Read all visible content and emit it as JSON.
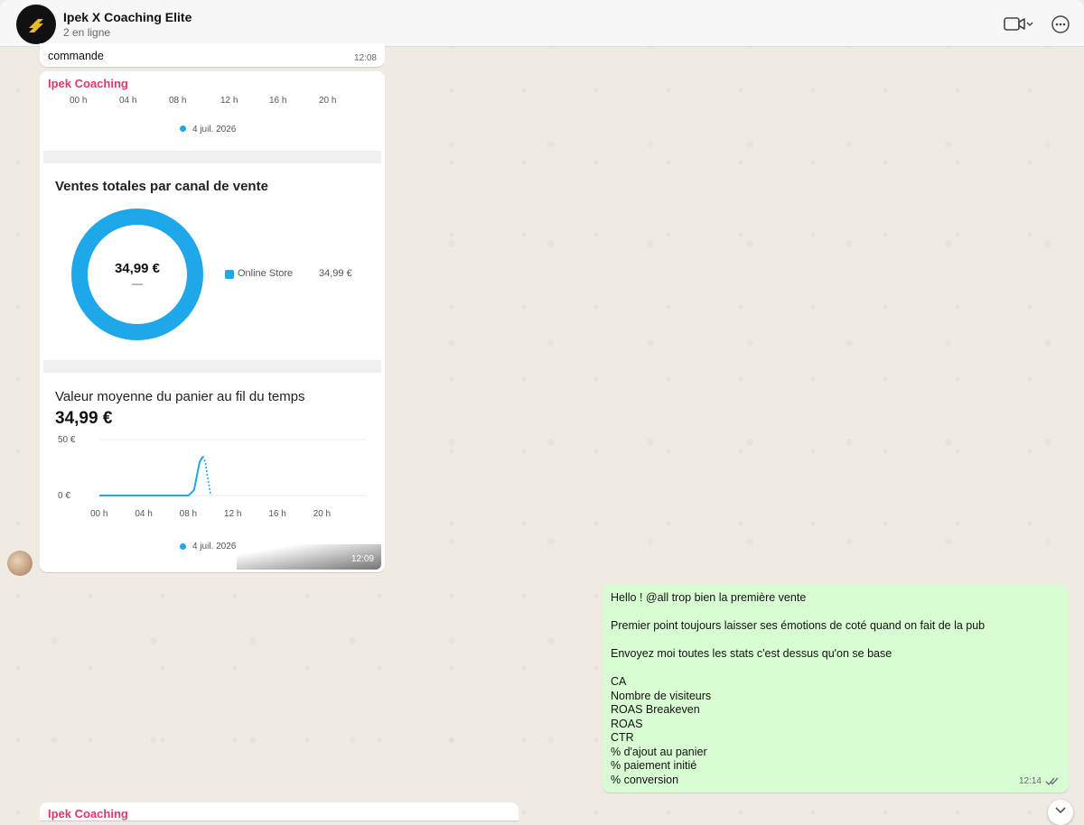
{
  "chat": {
    "title": "Ipek X Coaching Elite",
    "status": "2 en ligne"
  },
  "colors": {
    "accent": "#1ea7ea",
    "sender": "#e0366c",
    "outgoing": "#d9fdd3"
  },
  "msg_top": {
    "text": "commande",
    "time": "12:08"
  },
  "report": {
    "sender": "Ipek Coaching",
    "ticks": [
      "00 h",
      "04 h",
      "08 h",
      "12 h",
      "16 h",
      "20 h"
    ],
    "date_legend": "4 juil. 2026",
    "sales_channel": {
      "title": "Ventes totales par canal de vente",
      "total": "34,99 €",
      "dash": "—",
      "legend_label": "Online Store",
      "legend_value": "34,99 €"
    },
    "avg_cart": {
      "title": "Valeur moyenne du panier au fil du temps",
      "value": "34,99 €",
      "y_ticks": [
        "50 €",
        "0 €"
      ],
      "date_legend": "4 juil. 2026"
    },
    "time": "12:09"
  },
  "chart_data": [
    {
      "type": "pie",
      "title": "Ventes totales par canal de vente",
      "categories": [
        "Online Store"
      ],
      "values": [
        34.99
      ]
    },
    {
      "type": "line",
      "title": "Valeur moyenne du panier au fil du temps",
      "ylim": [
        0,
        50
      ],
      "x_ticks": [
        "00 h",
        "04 h",
        "08 h",
        "12 h",
        "16 h",
        "20 h"
      ],
      "series": [
        {
          "x": [
            0,
            1,
            2,
            3,
            4,
            5,
            6,
            7,
            8,
            8.5,
            9,
            9.3,
            9.5,
            10
          ],
          "y": [
            0,
            0,
            0,
            0,
            0,
            0,
            0,
            0,
            0,
            5,
            30,
            34.99,
            30,
            0
          ]
        }
      ]
    }
  ],
  "outgoing": {
    "lines": [
      "Hello ! @all trop bien la première vente",
      "",
      "Premier point toujours laisser ses émotions de coté quand on fait de la pub",
      "",
      "Envoyez moi toutes les stats c'est dessus qu'on se base",
      "",
      "CA",
      "Nombre de visiteurs",
      "ROAS Breakeven",
      "ROAS",
      "CTR",
      "% d'ajout au panier",
      "% paiement initié",
      "% conversion"
    ],
    "time": "12:14"
  },
  "msg_bottom": {
    "sender": "Ipek Coaching"
  }
}
